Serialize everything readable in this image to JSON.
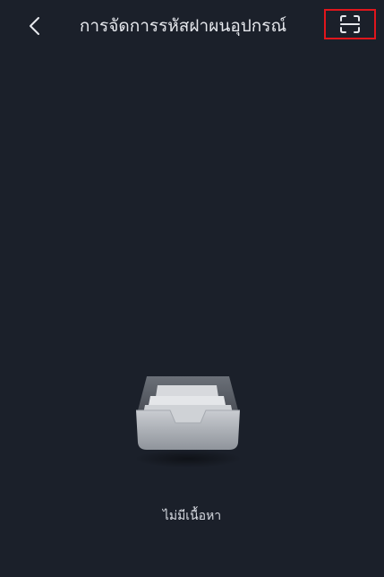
{
  "header": {
    "title": "การจัดการรหัสฝาผนอุปกรณ์",
    "back_icon": "chevron-left-icon",
    "scan_icon": "scan-frame-icon",
    "scan_highlight_color": "#e0161c"
  },
  "empty_state": {
    "icon": "empty-inbox-icon",
    "message": "ไม่มีเนื้อหา"
  },
  "theme": {
    "background": "#1b202a",
    "text": "#e7e9ee"
  }
}
